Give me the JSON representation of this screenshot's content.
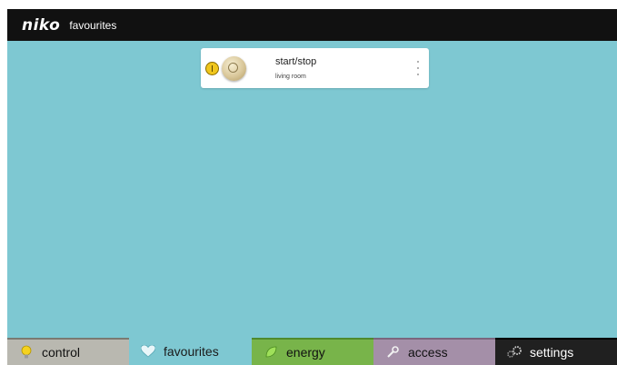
{
  "header": {
    "brand": "niko",
    "title": "favourites"
  },
  "favourite_card": {
    "title": "start/stop",
    "subtitle": "living room",
    "icons": {
      "badge": "power-badge-icon",
      "device": "dimmer-knob-icon",
      "menu": "more-vertical-icon"
    }
  },
  "nav": {
    "tabs": [
      {
        "label": "control",
        "icon": "bulb-icon",
        "color": "#b9b8b0",
        "active": false
      },
      {
        "label": "favourites",
        "icon": "heart-icon",
        "color": "#7ec8d2",
        "active": true
      },
      {
        "label": "energy",
        "icon": "leaf-icon",
        "color": "#78b44a",
        "active": false
      },
      {
        "label": "access",
        "icon": "wrench-icon",
        "color": "#a48fa8",
        "active": false
      },
      {
        "label": "settings",
        "icon": "gears-icon",
        "color": "#202020",
        "active": false
      }
    ]
  },
  "colors": {
    "background": "#7ec8d2",
    "topbar": "#111111"
  }
}
